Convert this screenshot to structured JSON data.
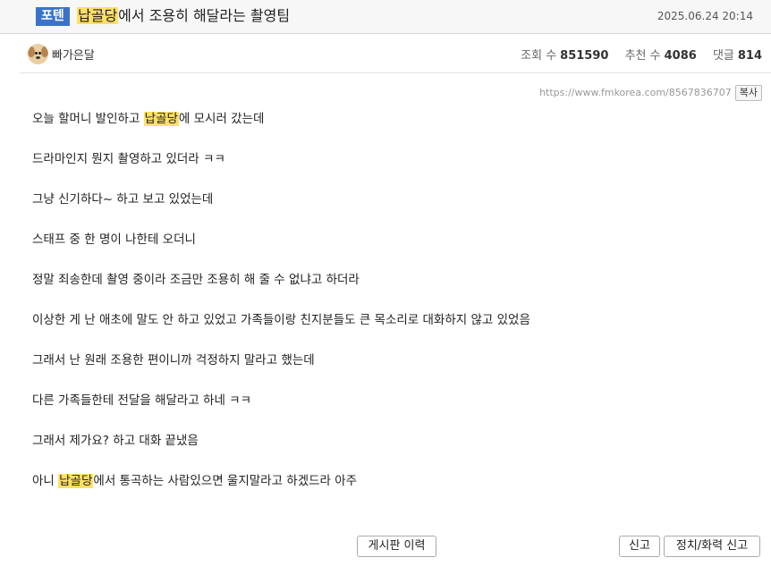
{
  "header": {
    "badge": "포텐",
    "title_highlight": "납골당",
    "title_rest": "에서 조용히 해달라는 촬영팀",
    "date": "2025.06.24 20:14"
  },
  "meta": {
    "nickname": "빠가은달",
    "views_label": "조회 수",
    "views": "851590",
    "votes_label": "추천 수",
    "votes": "4086",
    "comments_label": "댓글",
    "comments": "814"
  },
  "url_bar": {
    "url": "https://www.fmkorea.com/8567836707",
    "copy_label": "복사"
  },
  "paragraphs": [
    {
      "pre": "오늘 할머니 발인하고 ",
      "highlight": "납골당",
      "post": "에 모시러 갔는데"
    },
    {
      "pre": "드라마인지 뭔지 촬영하고 있더라 ㅋㅋ",
      "highlight": "",
      "post": ""
    },
    {
      "pre": "그냥 신기하다~ 하고 보고 있었는데",
      "highlight": "",
      "post": ""
    },
    {
      "pre": "스태프 중 한 명이 나한테 오더니",
      "highlight": "",
      "post": ""
    },
    {
      "pre": "정말 죄송한데 촬영 중이라 조금만 조용히 해 줄 수 없냐고 하더라",
      "highlight": "",
      "post": ""
    },
    {
      "pre": "이상한 게 난 애초에 말도 안 하고 있었고 가족들이랑 친지분들도 큰 목소리로 대화하지 않고 있었음",
      "highlight": "",
      "post": ""
    },
    {
      "pre": "그래서 난 원래 조용한 편이니까 걱정하지 말라고 했는데",
      "highlight": "",
      "post": ""
    },
    {
      "pre": "다른 가족들한테 전달을 해달라고 하네 ㅋㅋ",
      "highlight": "",
      "post": ""
    },
    {
      "pre": "그래서 제가요? 하고 대화 끝냈음",
      "highlight": "",
      "post": ""
    },
    {
      "pre": "아니 ",
      "highlight": "납골당",
      "post": "에서 통곡하는 사람있으면 울지말라고 하겠드라 아주"
    }
  ],
  "footer": {
    "history_label": "게시판 이력",
    "report_label": "신고",
    "report_politics_label": "정치/화력 신고"
  },
  "colors": {
    "badge_bg": "#3c73c9",
    "highlight": "#ffe066"
  }
}
